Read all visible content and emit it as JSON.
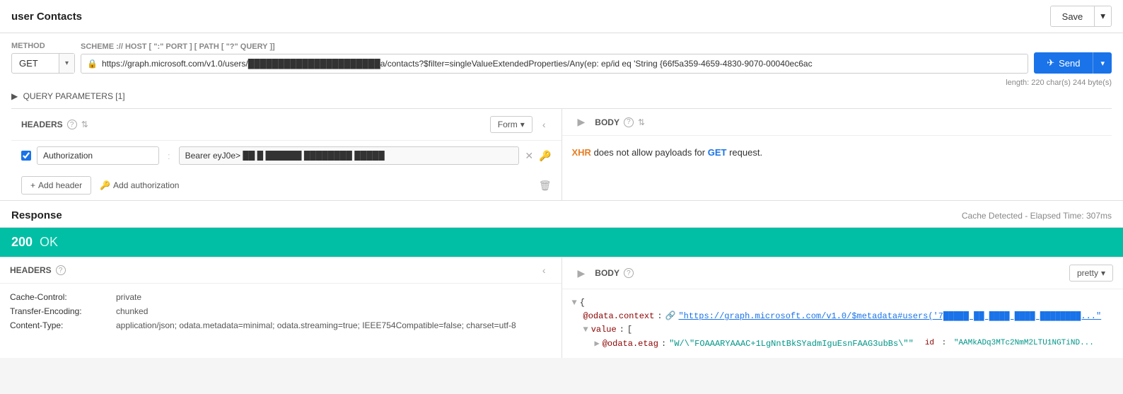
{
  "topbar": {
    "title": "user Contacts",
    "save_label": "Save"
  },
  "request": {
    "method_label": "METHOD",
    "method": "GET",
    "url_scheme_label": "SCHEME :// HOST [ \":\" PORT ] [ PATH [ \"?\" QUERY ]]",
    "url": "https://graph.microsoft.com/v1.0/users/██████████████████████a/contacts?$filter=singleValueExtendedProperties/Any(ep: ep/id eq 'String {66f5a359-4659-4830-9070-00040ec6ac",
    "url_meta": "length: 220 char(s) 244 byte(s)",
    "send_label": "Send",
    "query_params_label": "QUERY PARAMETERS [1]"
  },
  "headers_section": {
    "title": "HEADERS",
    "form_label": "Form",
    "body_title": "BODY",
    "header_row": {
      "key": "Authorization",
      "value": "Bearer eyJ0e> ██ █ ██████ ████████ █████"
    },
    "add_header_label": "+ Add header",
    "add_auth_label": "Add authorization",
    "body_message": "XHR does not allow payloads for GET request."
  },
  "response": {
    "title": "Response",
    "cache_info": "Cache Detected - Elapsed Time: 307ms",
    "status_code": "200",
    "status_text": "OK",
    "headers_title": "HEADERS",
    "body_title": "BODY",
    "pretty_label": "pretty",
    "headers": [
      {
        "key": "Cache-Control:",
        "value": "private"
      },
      {
        "key": "Transfer-Encoding:",
        "value": "chunked"
      },
      {
        "key": "Content-Type:",
        "value": "application/json; odata.metadata=minimal; odata.streaming=true; IEEE754Compatible=false; charset=utf-8"
      }
    ],
    "body": {
      "context_key": "@odata.context",
      "context_link": "https://graph.microsoft.com/v1.0/$metadata#users('7█████ ██ ████ ████ ████████...",
      "value_key": "value",
      "value_array_label": "[",
      "etag_key": "@odata.etag",
      "etag_value": "\"W/\\\"FOAAARYAAAC+1LgNntBkSYadmIguEsnFAAG3ubBs\\\"\"",
      "id_key": "id",
      "id_value": "\"AAMkADq3MTc2NmM2LTU1NGTiND..."
    }
  }
}
